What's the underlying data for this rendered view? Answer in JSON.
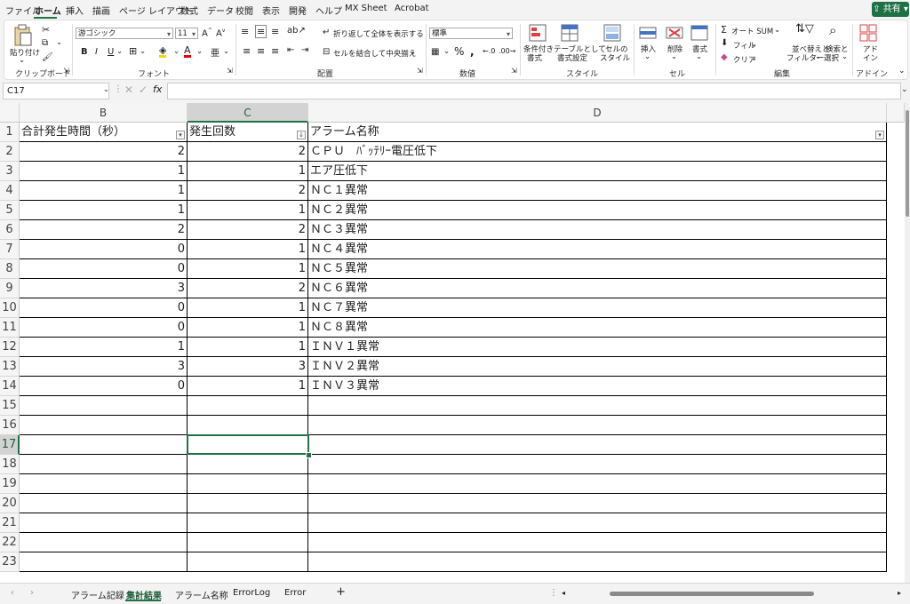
{
  "menu_tabs": [
    "ファイル",
    "ホーム",
    "挿入",
    "描画",
    "ページ レイアウト",
    "数式",
    "データ",
    "校閲",
    "表示",
    "開発",
    "ヘルプ",
    "MX Sheet",
    "Acrobat"
  ],
  "share_label": "共有",
  "ribbon": {
    "clipboard": {
      "paste": "貼り付け",
      "group": "クリップボード"
    },
    "font": {
      "name": "游ゴシック",
      "size": "11",
      "group": "フォント"
    },
    "alignment": {
      "wrap": "折り返して全体を表示する",
      "merge": "セルを結合して中央揃え",
      "group": "配置"
    },
    "number": {
      "format": "標準",
      "group": "数値"
    },
    "styles": {
      "cond": "条件付き",
      "cond2": "書式",
      "table": "テーブルとして",
      "table2": "書式設定",
      "cell": "セルの",
      "cell2": "スタイル",
      "group": "スタイル"
    },
    "cells": {
      "insert": "挿入",
      "delete": "削除",
      "format": "書式",
      "group": "セル"
    },
    "editing": {
      "autosum": "オート SUM",
      "fill": "フィル",
      "clear": "クリア",
      "sort": "並べ替えと",
      "sort2": "フィルター",
      "find": "検索と",
      "find2": "選択",
      "group": "編集"
    },
    "addins": {
      "label": "アド",
      "label2": "イン",
      "group": "アドイン"
    }
  },
  "namebox": "C17",
  "fx": "fx",
  "columns": [
    "B",
    "C",
    "D"
  ],
  "selected_column": "C",
  "selected_row": 17,
  "rows": [
    1,
    2,
    3,
    4,
    5,
    6,
    7,
    8,
    9,
    10,
    11,
    12,
    13,
    14,
    15,
    16,
    17,
    18,
    19,
    20,
    21,
    22,
    23
  ],
  "headers": [
    "合計発生時間（秒）",
    "発生回数",
    "アラーム名称"
  ],
  "table": [
    {
      "time": "2",
      "count": "2",
      "name": "ＣＰＵ　ﾊﾞｯﾃﾘｰ電圧低下"
    },
    {
      "time": "1",
      "count": "1",
      "name": "エア圧低下"
    },
    {
      "time": "1",
      "count": "2",
      "name": "ＮＣ１異常"
    },
    {
      "time": "1",
      "count": "1",
      "name": "ＮＣ２異常"
    },
    {
      "time": "2",
      "count": "2",
      "name": "ＮＣ３異常"
    },
    {
      "time": "0",
      "count": "1",
      "name": "ＮＣ４異常"
    },
    {
      "time": "0",
      "count": "1",
      "name": "ＮＣ５異常"
    },
    {
      "time": "3",
      "count": "2",
      "name": "ＮＣ６異常"
    },
    {
      "time": "0",
      "count": "1",
      "name": "ＮＣ７異常"
    },
    {
      "time": "0",
      "count": "1",
      "name": "ＮＣ８異常"
    },
    {
      "time": "1",
      "count": "1",
      "name": "ＩＮＶ１異常"
    },
    {
      "time": "3",
      "count": "3",
      "name": "ＩＮＶ２異常"
    },
    {
      "time": "0",
      "count": "1",
      "name": "ＩＮＶ３異常"
    }
  ],
  "sheet_tabs": [
    "アラーム記録",
    "集計結果",
    "アラーム名称",
    "ErrorLog",
    "Error"
  ],
  "active_sheet": "集計結果",
  "colors": {
    "accent": "#217346"
  }
}
